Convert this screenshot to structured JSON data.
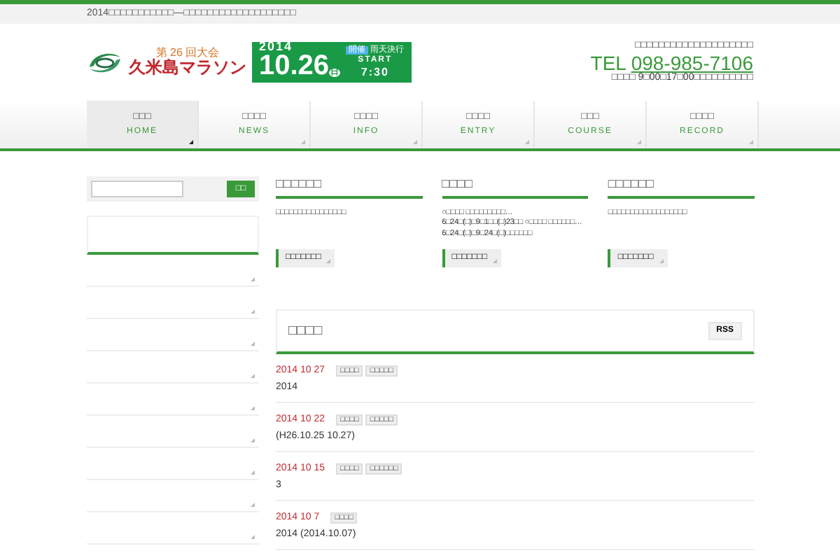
{
  "top_bar": {
    "text": "2014□□□□□□□□□□□—□□□□□□□□□□□□□□□□□□□"
  },
  "header": {
    "logo": {
      "edition": "第 26 回大会",
      "title": "久米島マラソン"
    },
    "event": {
      "year": "2014",
      "status": "開催",
      "note": "雨天決行",
      "date": "10.26",
      "weekday": "日",
      "start": "START",
      "time": "7:30"
    },
    "contact": {
      "line": "□□□□□□□□□□□□□□□□□□□□",
      "tel_label": "TEL",
      "tel": "098-985-7106",
      "hours": "□□□□ 9□00□17□00□□□□□□□□□□"
    }
  },
  "nav": [
    {
      "label": "□□□",
      "sub": "HOME",
      "selected": true
    },
    {
      "label": "□□□□",
      "sub": "NEWS",
      "selected": false
    },
    {
      "label": "□□□□",
      "sub": "INFO",
      "selected": false
    },
    {
      "label": "□□□□",
      "sub": "ENTRY",
      "selected": false
    },
    {
      "label": "□□□",
      "sub": "COURSE",
      "selected": false
    },
    {
      "label": "□□□□",
      "sub": "RECORD",
      "selected": false
    }
  ],
  "sidebar": {
    "search": {
      "button": "□□"
    }
  },
  "columns": [
    {
      "heading": "□□□□□□",
      "text": "□□□□□□□□□□□□□□□□",
      "button": "□□□□□□□"
    },
    {
      "heading": "□□□□",
      "text": "○□□□□ □□□□□□□□□…6□24□(□)□9□1□□(□)23□□ ○□□□□ □□□□□□…6□24□(□)□9□24□(□)□□□□□□",
      "button": "□□□□□□□"
    },
    {
      "heading": "□□□□□□",
      "text": "□□□□□□□□□□□□□□□□□□",
      "button": "□□□□□□□"
    }
  ],
  "news": {
    "title": "□□□□",
    "rss": "RSS",
    "items": [
      {
        "date": "2014 10 27",
        "tags": [
          "□□□□",
          "□□□□□"
        ],
        "text": "2014"
      },
      {
        "date": "2014 10 22",
        "tags": [
          "□□□□",
          "□□□□□"
        ],
        "text": "(H26.10.25 10.27)"
      },
      {
        "date": "2014 10 15",
        "tags": [
          "□□□□",
          "□□□□□□"
        ],
        "text": "3"
      },
      {
        "date": "2014 10 7",
        "tags": [
          "□□□□"
        ],
        "text": "2014 (2014.10.07)"
      }
    ]
  }
}
